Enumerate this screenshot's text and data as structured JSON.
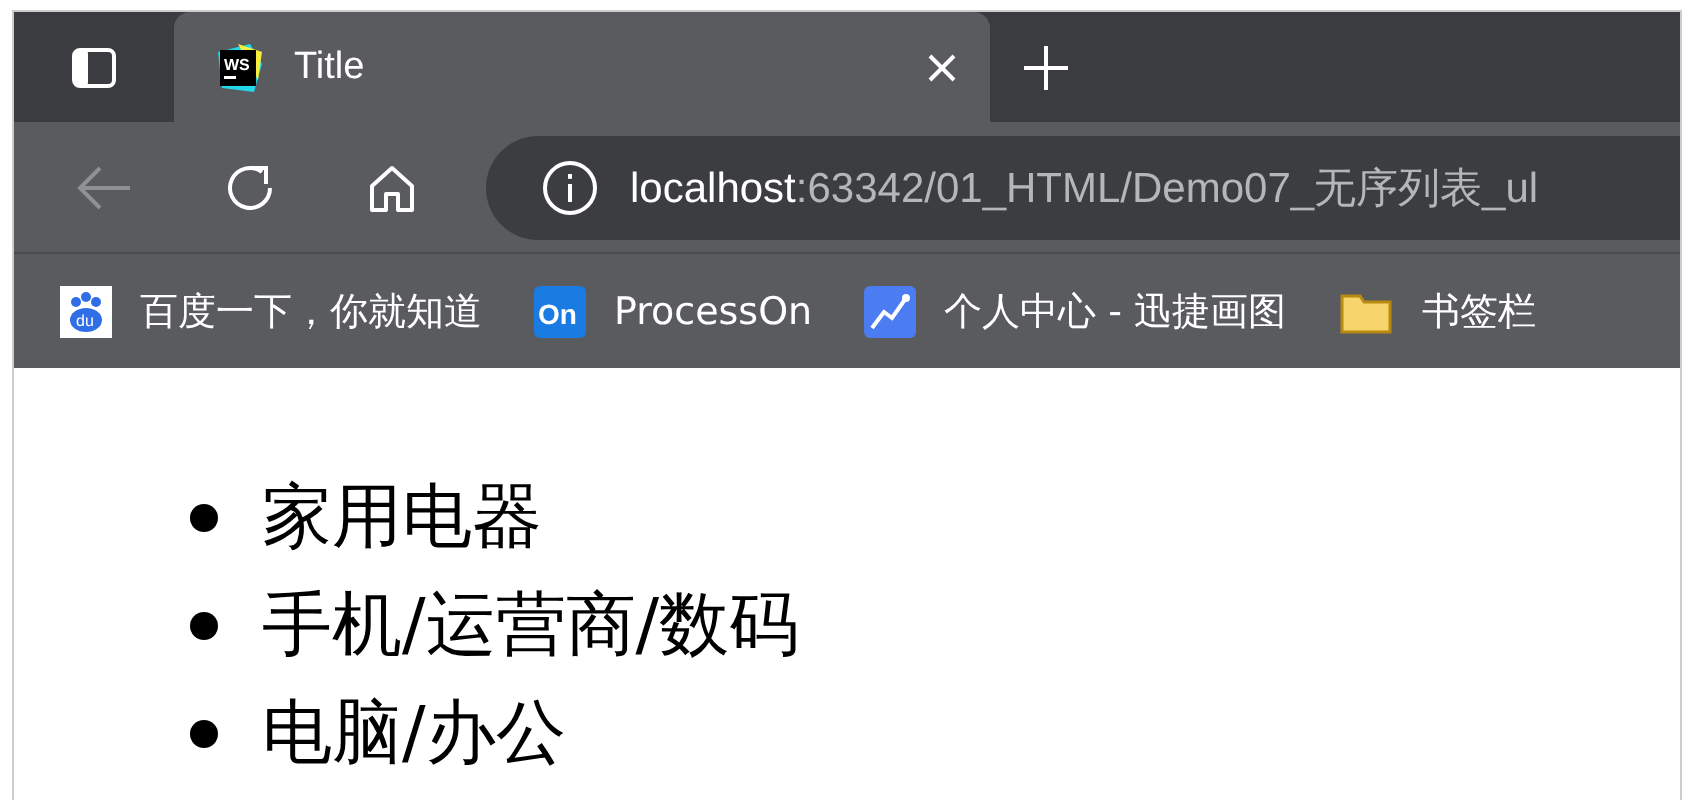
{
  "tabs": [
    {
      "title": "Title",
      "icon_text": "WS",
      "selected": true
    }
  ],
  "address": {
    "host": "localhost",
    "path": ":63342/01_HTML/Demo07_无序列表_ul"
  },
  "bookmarks": [
    {
      "kind": "baidu",
      "icon_text": "du",
      "label": "百度一下，你就知道"
    },
    {
      "kind": "processon",
      "icon_text": "On",
      "label": "ProcessOn"
    },
    {
      "kind": "chart",
      "label": "个人中心 - 迅捷画图"
    },
    {
      "kind": "folder",
      "label": "书签栏"
    }
  ],
  "list": [
    "家用电器",
    "手机/运营商/数码",
    "电脑/办公"
  ]
}
